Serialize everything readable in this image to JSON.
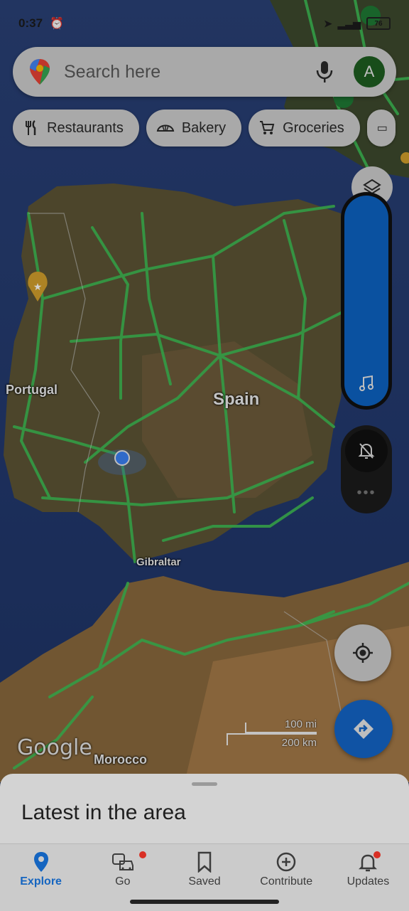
{
  "status": {
    "time": "0:37",
    "battery": "76"
  },
  "search": {
    "placeholder": "Search here",
    "avatar_letter": "A"
  },
  "chips": [
    {
      "label": "Restaurants",
      "icon": "fork-knife-icon"
    },
    {
      "label": "Bakery",
      "icon": "bread-icon"
    },
    {
      "label": "Groceries",
      "icon": "cart-icon"
    }
  ],
  "map": {
    "labels": {
      "portugal": "Portugal",
      "spain": "Spain",
      "gibraltar": "Gibraltar",
      "morocco": "Morocco"
    },
    "google_logo": "Google",
    "scale": {
      "mi": "100 mi",
      "km": "200 km"
    }
  },
  "sheet": {
    "title": "Latest in the area"
  },
  "nav": {
    "explore": "Explore",
    "go": "Go",
    "saved": "Saved",
    "contribute": "Contribute",
    "updates": "Updates"
  },
  "colors": {
    "accent": "#1565c0",
    "roads": "#3fbf55",
    "sea": "#1f3a7a",
    "land": "#6b5a3a"
  }
}
